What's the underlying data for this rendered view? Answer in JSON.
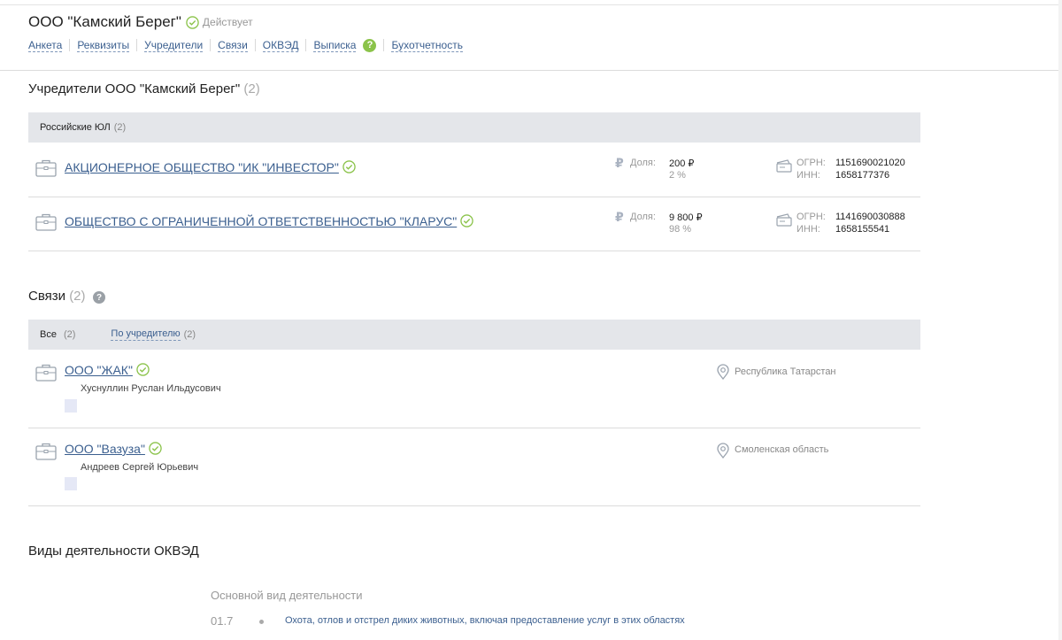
{
  "company": {
    "title": "ООО \"Камский Берег\"",
    "status": "Действует"
  },
  "tabs": [
    "Анкета",
    "Реквизиты",
    "Учредители",
    "Связи",
    "ОКВЭД",
    "Выписка",
    "Бухотчетность"
  ],
  "founders": {
    "title": "Учредители ООО \"Камский Берег\"",
    "count": "(2)",
    "band_label": "Российские ЮЛ",
    "band_count": "(2)",
    "items": [
      {
        "name": "АКЦИОНЕРНОЕ ОБЩЕСТВО \"ИК \"ИНВЕСТОР\"",
        "share_label": "Доля:",
        "share_amount": "200 ₽",
        "share_percent": "2 %",
        "ogrn_label": "ОГРН:",
        "ogrn": "1151690021020",
        "inn_label": "ИНН:",
        "inn": "1658177376"
      },
      {
        "name": "ОБЩЕСТВО С ОГРАНИЧЕННОЙ ОТВЕТСТВЕННОСТЬЮ \"КЛАРУС\"",
        "share_label": "Доля:",
        "share_amount": "9 800 ₽",
        "share_percent": "98 %",
        "ogrn_label": "ОГРН:",
        "ogrn": "1141690030888",
        "inn_label": "ИНН:",
        "inn": "1658155541"
      }
    ]
  },
  "links": {
    "title": "Связи",
    "count": "(2)",
    "filter_all": "Все",
    "filter_all_count": "(2)",
    "filter_founder": "По учредителю",
    "filter_founder_count": "(2)",
    "items": [
      {
        "name": "ООО \"ЖАК\"",
        "person": "Хуснуллин Руслан Ильдусович",
        "region": "Республика Татарстан"
      },
      {
        "name": "ООО \"Вазуза\"",
        "person": "Андреев Сергей Юрьевич",
        "region": "Смоленская область"
      }
    ]
  },
  "okved": {
    "title": "Виды деятельности ОКВЭД",
    "subtitle": "Основной вид деятельности",
    "code": "01.7",
    "description": "Охота, отлов и отстрел диких животных, включая предоставление услуг в этих областях"
  },
  "icons": {
    "ok": "check-circle-icon",
    "org": "briefcase-icon",
    "ruble": "ruble-icon",
    "card": "id-card-icon",
    "pin": "location-pin-icon",
    "help": "question-icon"
  },
  "colors": {
    "link": "#3b5f8f",
    "ok_green": "#8bc34a",
    "band": "#e4e6ea"
  }
}
